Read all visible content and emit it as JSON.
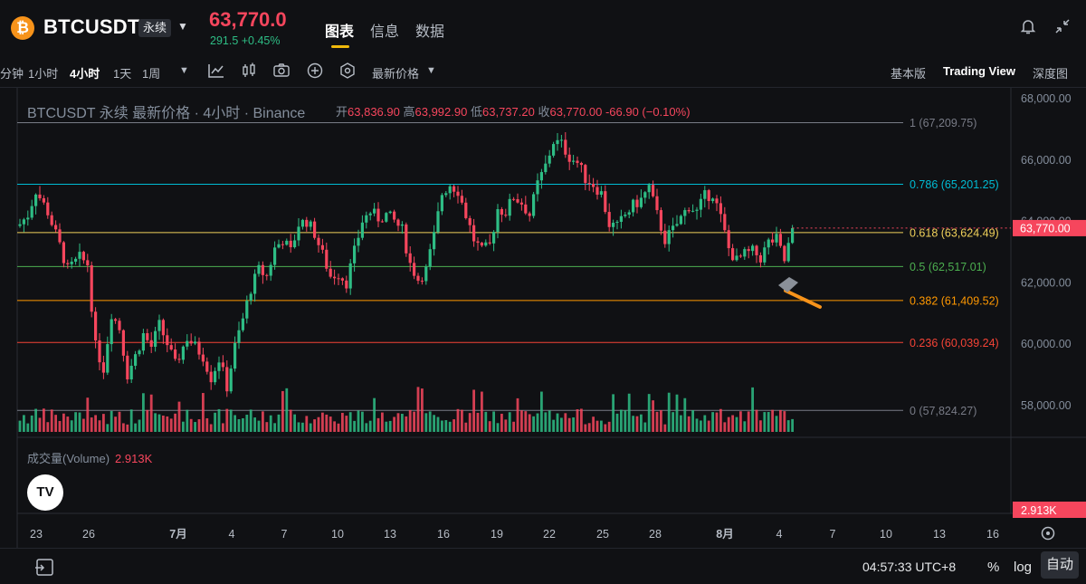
{
  "header": {
    "coin_icon_glyph": "₿",
    "symbol": "BTCUSDT",
    "badge": "永续",
    "last_price": "63,770.0",
    "price_change": "291.5 +0.45%",
    "tabs": [
      "图表",
      "信息",
      "数据"
    ],
    "active_tab": "图表"
  },
  "toolbar": {
    "timeframes": [
      "分钟",
      "1小时",
      "4小时",
      "1天",
      "1周"
    ],
    "active_timeframe": "4小时",
    "price_type": "最新价格",
    "views": [
      "基本版",
      "Trading View",
      "深度图"
    ],
    "active_view": "Trading View"
  },
  "legend": {
    "title": "BTCUSDT 永续 最新价格 · 4小时 · Binance",
    "open_label": "开",
    "open": "63,836.90",
    "high_label": "高",
    "high": "63,992.90",
    "low_label": "低",
    "low": "63,737.20",
    "close_label": "收",
    "close": "63,770.00",
    "change": "-66.90 (−0.10%)"
  },
  "volume_legend": {
    "label": "成交量(Volume)",
    "value": "2.913K"
  },
  "tv_logo": "TV",
  "chart_data": {
    "type": "candlestick",
    "symbol": "BTCUSDT",
    "interval": "4小时",
    "y_ticks": [
      58000,
      60000,
      62000,
      64000,
      66000,
      68000
    ],
    "y_tick_labels": [
      "58,000.00",
      "60,000.00",
      "62,000.00",
      "64,000.00",
      "66,000.00",
      "68,000.00"
    ],
    "ylim": [
      57300,
      68200
    ],
    "current_price": 63770,
    "current_price_label": "63,770.00",
    "fib_levels": [
      {
        "ratio": "1",
        "value": 67209.75,
        "label": "1 (67,209.75)",
        "color": "#787b86"
      },
      {
        "ratio": "0.786",
        "value": 65201.25,
        "label": "0.786 (65,201.25)",
        "color": "#00bcd4"
      },
      {
        "ratio": "0.618",
        "value": 63624.49,
        "label": "0.618 (63,624.49)",
        "color": "#f0d15a"
      },
      {
        "ratio": "0.5",
        "value": 62517.01,
        "label": "0.5 (62,517.01)",
        "color": "#4caf50"
      },
      {
        "ratio": "0.382",
        "value": 61409.52,
        "label": "0.382 (61,409.52)",
        "color": "#ff9800"
      },
      {
        "ratio": "0.236",
        "value": 60039.24,
        "label": "0.236 (60,039.24)",
        "color": "#f44336"
      },
      {
        "ratio": "0",
        "value": 57824.27,
        "label": "0 (57,824.27)",
        "color": "#787b86"
      }
    ],
    "x_ticks": [
      "23",
      "26",
      "7月",
      "4",
      "7",
      "10",
      "13",
      "16",
      "19",
      "22",
      "25",
      "28",
      "8月",
      "4",
      "7",
      "10",
      "13",
      "16"
    ],
    "price_path": [
      [
        0,
        63900
      ],
      [
        2,
        64200
      ],
      [
        4,
        65000
      ],
      [
        7,
        64300
      ],
      [
        10,
        63200
      ],
      [
        12,
        62400
      ],
      [
        15,
        62800
      ],
      [
        17,
        62600
      ],
      [
        19,
        59900
      ],
      [
        21,
        59200
      ],
      [
        23,
        61000
      ],
      [
        25,
        60500
      ],
      [
        27,
        59000
      ],
      [
        29,
        59600
      ],
      [
        31,
        60300
      ],
      [
        33,
        59900
      ],
      [
        35,
        60600
      ],
      [
        37,
        60000
      ],
      [
        39,
        59300
      ],
      [
        42,
        60200
      ],
      [
        44,
        59900
      ],
      [
        46,
        59600
      ],
      [
        48,
        58900
      ],
      [
        50,
        59500
      ],
      [
        52,
        58600
      ],
      [
        54,
        59900
      ],
      [
        56,
        60800
      ],
      [
        58,
        61800
      ],
      [
        60,
        62400
      ],
      [
        62,
        62200
      ],
      [
        64,
        63100
      ],
      [
        66,
        63400
      ],
      [
        68,
        63000
      ],
      [
        70,
        63900
      ],
      [
        72,
        64000
      ],
      [
        74,
        63600
      ],
      [
        76,
        62900
      ],
      [
        78,
        62200
      ],
      [
        80,
        62300
      ],
      [
        82,
        62000
      ],
      [
        84,
        63000
      ],
      [
        86,
        64000
      ],
      [
        88,
        64300
      ],
      [
        90,
        64100
      ],
      [
        92,
        64200
      ],
      [
        94,
        64000
      ],
      [
        96,
        63700
      ],
      [
        98,
        62600
      ],
      [
        100,
        62100
      ],
      [
        102,
        62400
      ],
      [
        104,
        63500
      ],
      [
        106,
        64900
      ],
      [
        108,
        65200
      ],
      [
        110,
        65000
      ],
      [
        112,
        64200
      ],
      [
        114,
        63400
      ],
      [
        116,
        63000
      ],
      [
        118,
        63200
      ],
      [
        120,
        64400
      ],
      [
        122,
        64300
      ],
      [
        124,
        64800
      ],
      [
        126,
        64600
      ],
      [
        128,
        64200
      ],
      [
        130,
        65200
      ],
      [
        132,
        65800
      ],
      [
        134,
        66600
      ],
      [
        136,
        66500
      ],
      [
        138,
        66100
      ],
      [
        140,
        65900
      ],
      [
        142,
        65400
      ],
      [
        144,
        65200
      ],
      [
        146,
        64900
      ],
      [
        148,
        63900
      ],
      [
        150,
        63800
      ],
      [
        152,
        64200
      ],
      [
        154,
        64500
      ],
      [
        156,
        64700
      ],
      [
        158,
        65100
      ],
      [
        160,
        64200
      ],
      [
        162,
        63400
      ],
      [
        164,
        63700
      ],
      [
        166,
        64100
      ],
      [
        168,
        64500
      ],
      [
        170,
        64300
      ],
      [
        172,
        64800
      ],
      [
        174,
        64900
      ],
      [
        176,
        64100
      ],
      [
        178,
        63100
      ],
      [
        180,
        62700
      ],
      [
        182,
        62900
      ],
      [
        184,
        63000
      ],
      [
        186,
        62800
      ],
      [
        188,
        63300
      ],
      [
        190,
        63400
      ],
      [
        192,
        62700
      ],
      [
        194,
        63700
      ]
    ]
  },
  "bottom_bar": {
    "clock": "04:57:33 UTC+8",
    "percent": "%",
    "log": "log",
    "auto": "自动"
  }
}
